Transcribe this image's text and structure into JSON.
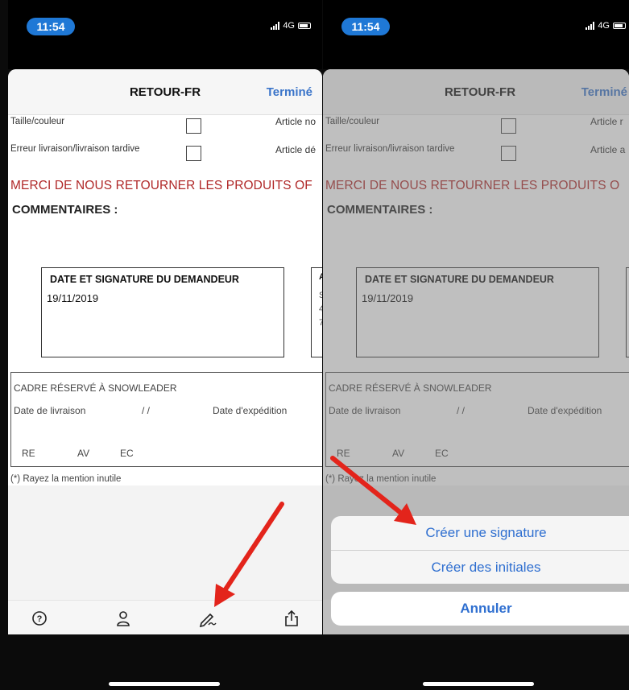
{
  "status": {
    "time": "11:54",
    "network": "4G"
  },
  "nav": {
    "title": "RETOUR-FR",
    "done": "Terminé"
  },
  "form": {
    "row1_label": "Taille/couleur",
    "row1_article": "Article no",
    "row2_label": "Erreur livraison/livraison tardive",
    "row2_article": "Article dé",
    "row1_article_right": "Article r",
    "row2_article_right": "Article a",
    "merci_left": "MERCI DE NOUS RETOURNER LES PRODUITS OF",
    "merci_right": "MERCI DE NOUS RETOURNER LES PRODUITS O",
    "commentaires": "COMMENTAIRES :",
    "signature_box_title": "DATE ET SIGNATURE DU DEMANDEUR",
    "signature_date": "19/11/2019",
    "next_box_chars": [
      "A",
      "S",
      "4",
      "7"
    ],
    "cadre_title": "CADRE RÉSERVÉ À SNOWLEADER",
    "date_livraison": "Date de livraison",
    "slashes": "/        /",
    "date_expedition": "Date d'expédition",
    "re": "RE",
    "av": "AV",
    "ec": "EC",
    "rayez": "(*) Rayez la mention inutile"
  },
  "toolbar": {
    "icons": [
      "help-icon",
      "person-icon",
      "signature-pen-icon",
      "share-icon"
    ]
  },
  "action_sheet": {
    "create_signature": "Créer une signature",
    "create_initials": "Créer des initiales",
    "cancel": "Annuler"
  },
  "colors": {
    "accent": "#2f6fd0",
    "warning_text": "#b02828",
    "arrow": "#e3241b",
    "time_pill": "#1f78d6"
  }
}
